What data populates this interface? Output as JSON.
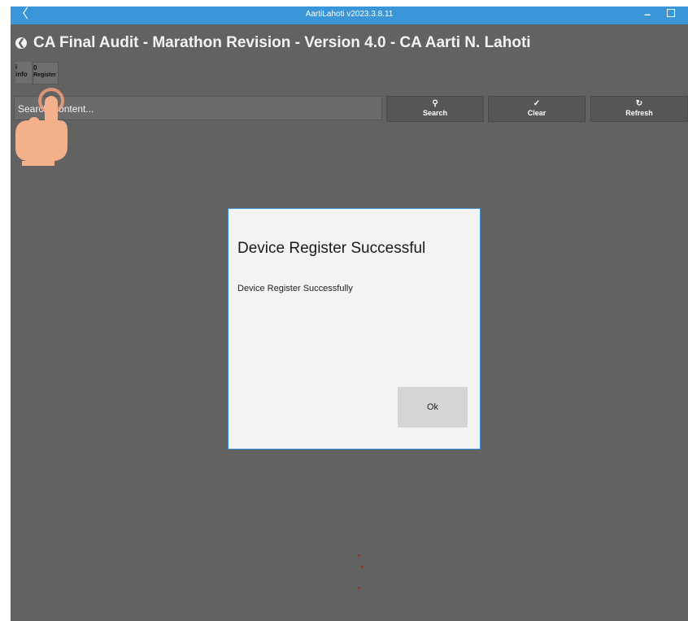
{
  "titlebar": {
    "back_glyph": "〈",
    "title": "AartiLahoti v2023.3.8.11",
    "minimize_glyph": "–"
  },
  "header": {
    "back_icon_glyph": "❮",
    "title": "CA Final Audit - Marathon Revision - Version 4.0 - CA Aarti N. Lahoti"
  },
  "toolbar": {
    "info_icon": "i",
    "info_label": "info",
    "register_icon": "0",
    "register_label": "Register"
  },
  "search": {
    "placeholder": "Search Content...",
    "search_label": "Search",
    "clear_label": "Clear",
    "refresh_label": "Refresh"
  },
  "dialog": {
    "title": "Device Register Successful",
    "message": "Device Register Successfully",
    "ok_label": "Ok"
  },
  "colors": {
    "titlebar": "#3a95d9",
    "background": "#626262",
    "dialog_border": "#3d8fd6"
  }
}
